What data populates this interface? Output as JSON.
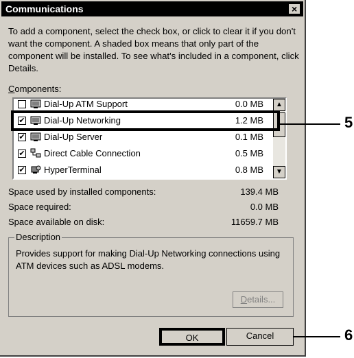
{
  "window": {
    "title": "Communications",
    "close_glyph": "×",
    "close_icon": "close-icon"
  },
  "intro": "To add a component, select the check box, or click to clear it if you don't want the component. A shaded box means that only part of the component will be installed. To see what's included in a component, click Details.",
  "components_label": {
    "underlined": "C",
    "rest": "omponents:"
  },
  "components": [
    {
      "name": "Dial-Up ATM Support",
      "size": "0.0 MB",
      "checked": false,
      "icon": "network-adapter-icon"
    },
    {
      "name": "Dial-Up Networking",
      "size": "1.2 MB",
      "checked": true,
      "icon": "network-adapter-icon"
    },
    {
      "name": "Dial-Up Server",
      "size": "0.1 MB",
      "checked": true,
      "icon": "network-adapter-icon"
    },
    {
      "name": "Direct Cable Connection",
      "size": "0.5 MB",
      "checked": true,
      "icon": "cable-connection-icon"
    },
    {
      "name": "HyperTerminal",
      "size": "0.8 MB",
      "checked": true,
      "icon": "hyperterminal-icon"
    }
  ],
  "checkmark": "✔",
  "space": [
    {
      "label": "Space used by installed components:",
      "value": "139.4 MB"
    },
    {
      "label": "Space required:",
      "value": "0.0 MB"
    },
    {
      "label": "Space available on disk:",
      "value": "11659.7 MB"
    }
  ],
  "description": {
    "label": "Description",
    "text": "Provides support for making Dial-Up Networking connections using ATM devices such as ADSL modems."
  },
  "buttons": {
    "details": {
      "underlined": "D",
      "rest": "etails..."
    },
    "ok": "OK",
    "cancel": "Cancel"
  },
  "scrollbar": {
    "up_arrow": "▲",
    "down_arrow": "▼"
  },
  "callouts": [
    "5",
    "6"
  ]
}
